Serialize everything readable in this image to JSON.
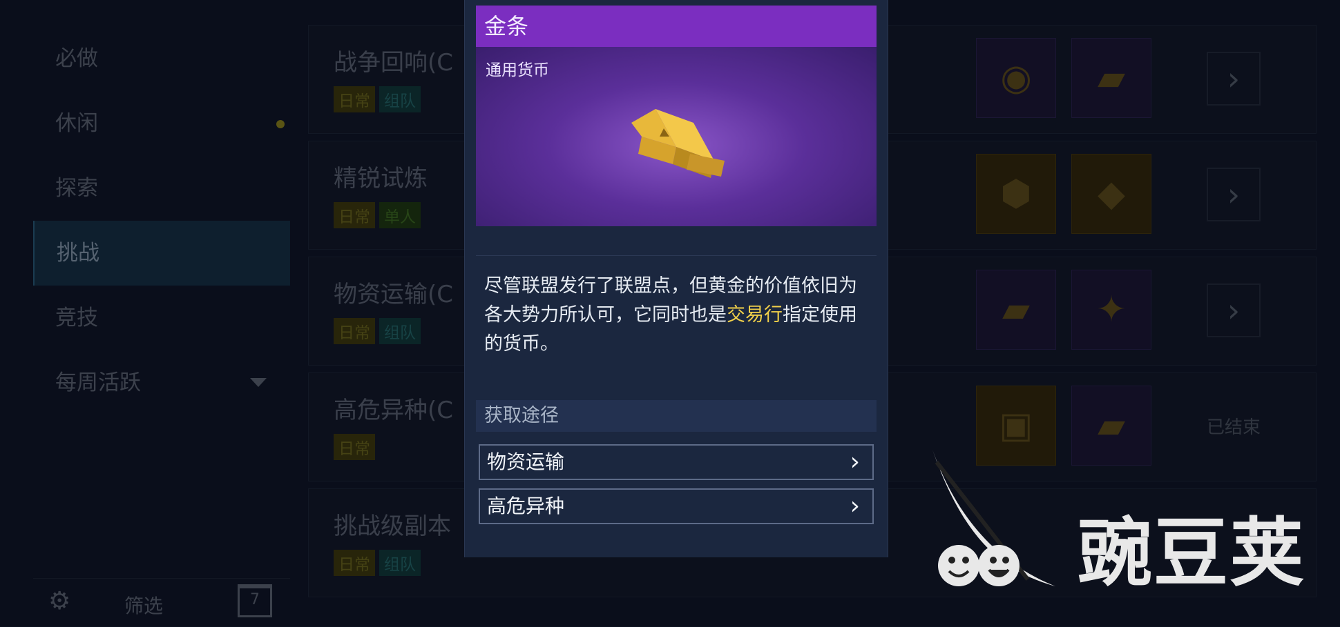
{
  "sidebar": {
    "items": [
      {
        "label": "必做"
      },
      {
        "label": "休闲"
      },
      {
        "label": "探索"
      },
      {
        "label": "挑战"
      },
      {
        "label": "竞技"
      },
      {
        "label": "每周活跃"
      }
    ],
    "filter_label": "筛选",
    "calendar_day": "7"
  },
  "activities": [
    {
      "title": "战争回响(C",
      "tags": [
        "日常",
        "组队"
      ]
    },
    {
      "title": "精锐试炼",
      "tags": [
        "日常",
        "单人"
      ]
    },
    {
      "title": "物资运输(C",
      "tags": [
        "日常",
        "组队"
      ]
    },
    {
      "title": "高危异种(C",
      "tags": [
        "日常"
      ],
      "status": "已结束"
    },
    {
      "title": "挑战级副本",
      "tags": [
        "日常",
        "组队"
      ]
    }
  ],
  "popup": {
    "title": "金条",
    "category": "通用货币",
    "description_before": "尽管联盟发行了联盟点，但黄金的价值依旧为各大势力所认可，它同时也是",
    "description_highlight": "交易行",
    "description_after": "指定使用的货币。",
    "source_header": "获取途径",
    "sources": [
      {
        "label": "物资运输"
      },
      {
        "label": "高危异种"
      }
    ]
  },
  "watermark": {
    "text": "豌豆荚"
  },
  "colors": {
    "title_bar": "#7b2ec0",
    "highlight": "#f1d04a",
    "popup_bg": "#1b273f"
  }
}
